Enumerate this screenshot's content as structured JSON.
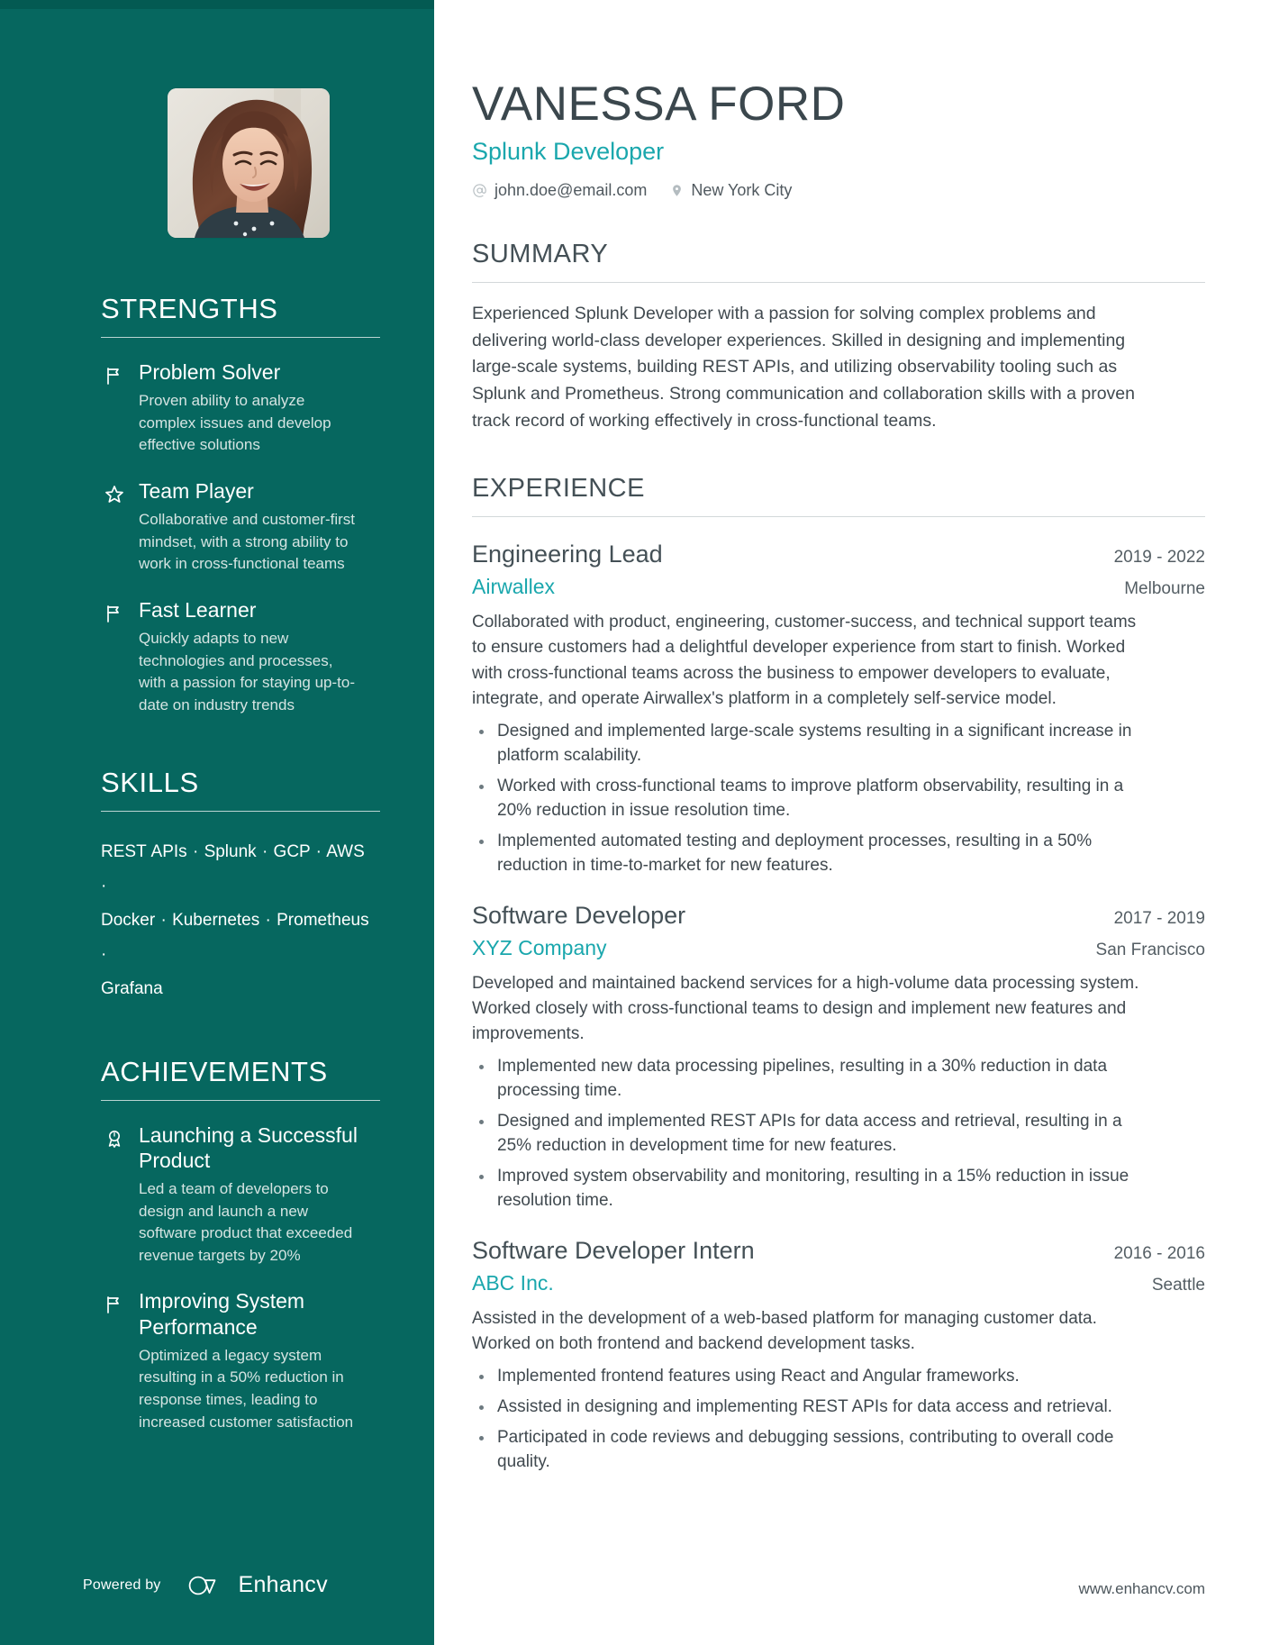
{
  "header": {
    "name": "VANESSA FORD",
    "role": "Splunk Developer",
    "email": "john.doe@email.com",
    "email_icon": "at-icon",
    "location": "New York City",
    "location_icon": "map-pin-icon",
    "photo_alt": "profile-photo"
  },
  "colors": {
    "sidebar_bg": "#06675f",
    "accent": "#1aa7ad",
    "heading": "#445056",
    "body": "#40494f"
  },
  "sidebar": {
    "strengths": {
      "heading": "STRENGTHS",
      "items": [
        {
          "icon": "flag-icon",
          "title": "Problem Solver",
          "description": "Proven ability to analyze complex issues and develop effective solutions"
        },
        {
          "icon": "star-icon",
          "title": "Team Player",
          "description": "Collaborative and customer-first mindset, with a strong ability to work in cross-functional teams"
        },
        {
          "icon": "flag-icon",
          "title": "Fast Learner",
          "description": "Quickly adapts to new technologies and processes, with a passion for staying up-to-date on industry trends"
        }
      ]
    },
    "skills": {
      "heading": "SKILLS",
      "lines": [
        "REST APIs · Splunk · GCP · AWS ·",
        "Docker · Kubernetes · Prometheus ·",
        "Grafana"
      ],
      "items": [
        "REST APIs",
        "Splunk",
        "GCP",
        "AWS",
        "Docker",
        "Kubernetes",
        "Prometheus",
        "Grafana"
      ]
    },
    "achievements": {
      "heading": "ACHIEVEMENTS",
      "items": [
        {
          "icon": "award-ribbon-icon",
          "title": "Launching a Successful Product",
          "description": "Led a team of developers to design and launch a new software product that exceeded revenue targets by 20%"
        },
        {
          "icon": "flag-icon",
          "title": "Improving System Performance",
          "description": "Optimized a legacy system resulting in a 50% reduction in response times, leading to increased customer satisfaction"
        }
      ]
    },
    "footer": {
      "powered_by": "Powered by",
      "brand": "Enhancv",
      "brand_icon": "enhancv-logo-icon"
    }
  },
  "main": {
    "summary": {
      "heading": "SUMMARY",
      "text": "Experienced Splunk Developer with a passion for solving complex problems and delivering world-class developer experiences. Skilled in designing and implementing large-scale systems, building REST APIs, and utilizing observability tooling such as Splunk and Prometheus. Strong communication and collaboration skills with a proven track record of working effectively in cross-functional teams."
    },
    "experience": {
      "heading": "EXPERIENCE",
      "jobs": [
        {
          "title": "Engineering Lead",
          "date": "2019 - 2022",
          "company": "Airwallex",
          "location": "Melbourne",
          "description": "Collaborated with product, engineering, customer-success, and technical support teams to ensure customers had a delightful developer experience from start to finish. Worked with cross-functional teams across the business to empower developers to evaluate, integrate, and operate Airwallex's platform in a completely self-service model.",
          "bullets": [
            "Designed and implemented large-scale systems resulting in a significant increase in platform scalability.",
            "Worked with cross-functional teams to improve platform observability, resulting in a 20% reduction in issue resolution time.",
            "Implemented automated testing and deployment processes, resulting in a 50% reduction in time-to-market for new features."
          ]
        },
        {
          "title": "Software Developer",
          "date": "2017 - 2019",
          "company": "XYZ Company",
          "location": "San Francisco",
          "description": "Developed and maintained backend services for a high-volume data processing system. Worked closely with cross-functional teams to design and implement new features and improvements.",
          "bullets": [
            "Implemented new data processing pipelines, resulting in a 30% reduction in data processing time.",
            "Designed and implemented REST APIs for data access and retrieval, resulting in a 25% reduction in development time for new features.",
            "Improved system observability and monitoring, resulting in a 15% reduction in issue resolution time."
          ]
        },
        {
          "title": "Software Developer Intern",
          "date": "2016 - 2016",
          "company": "ABC Inc.",
          "location": "Seattle",
          "description": "Assisted in the development of a web-based platform for managing customer data. Worked on both frontend and backend development tasks.",
          "bullets": [
            "Implemented frontend features using React and Angular frameworks.",
            "Assisted in designing and implementing REST APIs for data access and retrieval.",
            "Participated in code reviews and debugging sessions, contributing to overall code quality."
          ]
        }
      ]
    },
    "footer_url": "www.enhancv.com"
  }
}
